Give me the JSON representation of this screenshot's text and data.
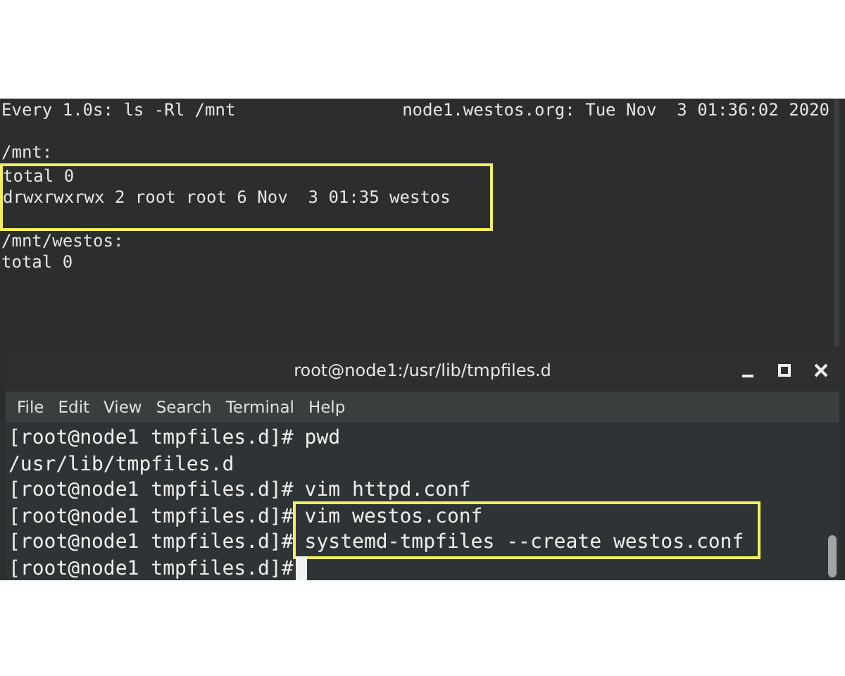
{
  "watch_terminal": {
    "header_left": "Every 1.0s: ls -Rl /mnt",
    "header_right": "node1.westos.org: Tue Nov  3 01:36:02 2020",
    "blocks": [
      {
        "lines": [
          "/mnt:"
        ],
        "highlighted": false
      },
      {
        "lines": [
          "total 0",
          "drwxrwxrwx 2 root root 6 Nov  3 01:35 westos"
        ],
        "highlighted": true
      },
      {
        "lines": [
          "/mnt/westos:",
          "total 0"
        ],
        "highlighted": false
      }
    ]
  },
  "window": {
    "title": "root@node1:/usr/lib/tmpfiles.d",
    "menu": [
      "File",
      "Edit",
      "View",
      "Search",
      "Terminal",
      "Help"
    ],
    "lines": [
      {
        "kind": "command",
        "prompt": "[root@node1 tmpfiles.d]#",
        "command": "pwd",
        "highlighted": false,
        "cursor": false
      },
      {
        "kind": "output",
        "text": "/usr/lib/tmpfiles.d"
      },
      {
        "kind": "command",
        "prompt": "[root@node1 tmpfiles.d]#",
        "command": "vim httpd.conf",
        "highlighted": false,
        "cursor": false
      },
      {
        "kind": "command",
        "prompt": "[root@node1 tmpfiles.d]#",
        "command": "vim westos.conf",
        "highlighted": true,
        "cursor": false
      },
      {
        "kind": "command",
        "prompt": "[root@node1 tmpfiles.d]#",
        "command": "systemd-tmpfiles --create westos.conf",
        "highlighted": true,
        "cursor": false
      },
      {
        "kind": "command",
        "prompt": "[root@node1 tmpfiles.d]#",
        "highlighted": false,
        "cursor": true
      }
    ]
  }
}
